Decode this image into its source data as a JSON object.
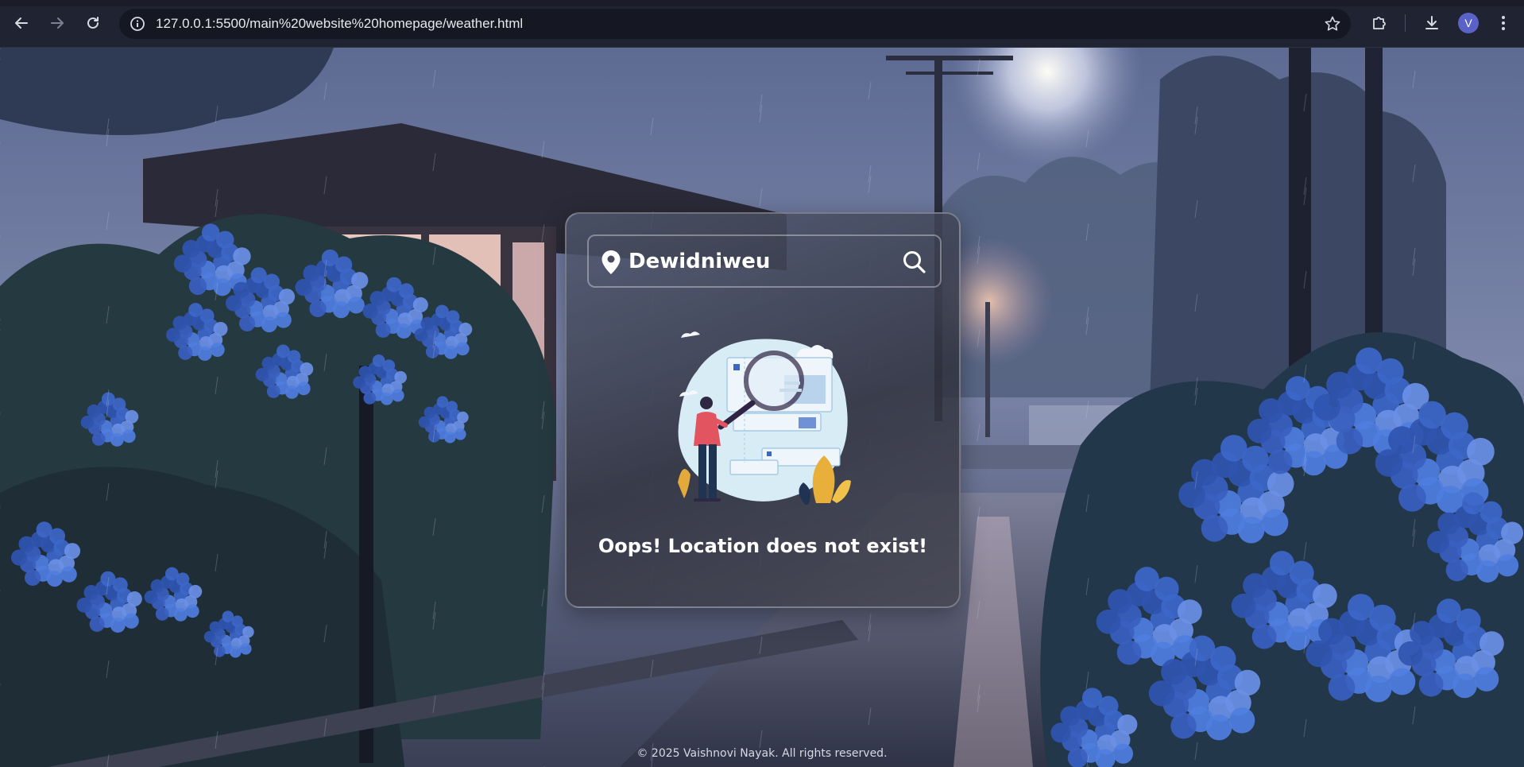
{
  "browser": {
    "url": "127.0.0.1:5500/main%20website%20homepage/weather.html",
    "profile_initial": "V",
    "icons": [
      "back-icon",
      "forward-icon",
      "reload-icon",
      "site-info-icon",
      "bookmark-star-icon",
      "extensions-icon",
      "download-icon",
      "menu-dots-icon"
    ]
  },
  "weather_card": {
    "search": {
      "value": "Dewidniweu",
      "icon_left": "location-pin-icon",
      "icon_right": "search-icon"
    },
    "error_message": "Oops! Location does not exist!",
    "illustration": "not-found-illustration"
  },
  "footer": {
    "text": "© 2025 Vaishnovi Nayak. All rights reserved."
  },
  "colors": {
    "chrome_bg": "#202432",
    "omnibox_bg": "#151822",
    "card_text": "#ffffff",
    "avatar": "#5a62c8",
    "hydrangea_blue": "#3e6cd0"
  }
}
